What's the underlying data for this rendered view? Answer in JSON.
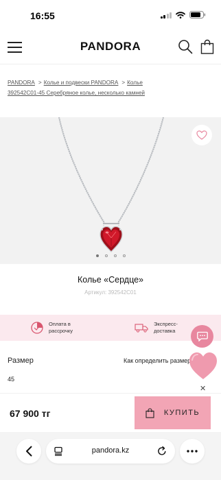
{
  "status": {
    "time": "16:55"
  },
  "header": {
    "logo": "PANDORA"
  },
  "breadcrumb": {
    "items": [
      "PANDORA",
      "Колье и подвески PANDORA",
      "Колье"
    ],
    "current": "392542C01-45 Серебряное колье, несколько камней",
    "separator": ">"
  },
  "product": {
    "title": "Колье «Сердце»",
    "sku": "Артикул: 392542C01",
    "gallery_count": 4,
    "gallery_active": 1
  },
  "benefits": [
    {
      "icon": "installment-icon",
      "line1": "Оплата в",
      "line2": "рассрочку"
    },
    {
      "icon": "delivery-truck-icon",
      "line1": "Экспресс-",
      "line2": "доставка"
    }
  ],
  "size": {
    "label": "Размер",
    "guide": "Как определить размер",
    "value": "45"
  },
  "buy": {
    "price": "67 900 тг",
    "button": "КУПИТЬ"
  },
  "browser": {
    "url": "pandora.kz"
  },
  "colors": {
    "accent_pink": "#f2a5b5",
    "chat_pink": "#e8879f",
    "band_pink": "#fbe9ee",
    "stone_red": "#c2121f"
  }
}
